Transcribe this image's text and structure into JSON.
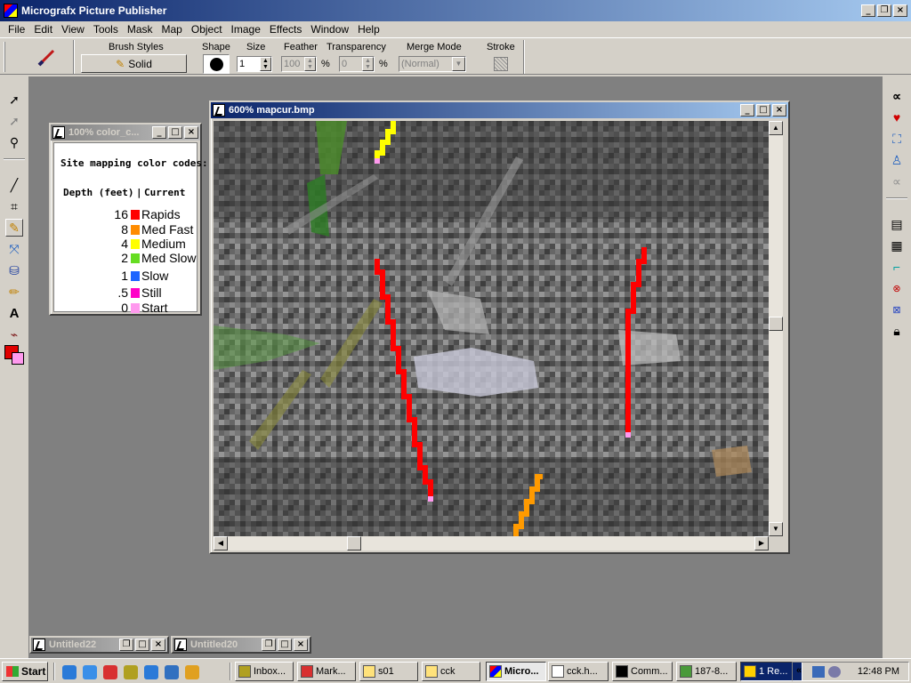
{
  "app": {
    "title": "Micrografx Picture Publisher",
    "menu": [
      "File",
      "Edit",
      "View",
      "Tools",
      "Mask",
      "Map",
      "Object",
      "Image",
      "Effects",
      "Window",
      "Help"
    ]
  },
  "toolbar": {
    "brush_styles_label": "Brush Styles",
    "brush_style_value": "Solid",
    "shape_label": "Shape",
    "size_label": "Size",
    "size_value": "1",
    "feather_label": "Feather",
    "feather_value": "100",
    "feather_unit": "%",
    "transparency_label": "Transparency",
    "transparency_value": "0",
    "transparency_unit": "%",
    "merge_mode_label": "Merge Mode",
    "merge_mode_value": "(Normal)",
    "stroke_label": "Stroke"
  },
  "legend_window": {
    "title": "100% color_c...",
    "heading": "Site mapping color codes:",
    "col_depth": "Depth (feet)",
    "col_sep": "|",
    "col_current": "Current",
    "rows": [
      {
        "depth": "16",
        "label": "Rapids",
        "color": "#ff0000"
      },
      {
        "depth": "8",
        "label": "Med Fast",
        "color": "#ff8c00"
      },
      {
        "depth": "4",
        "label": "Medium",
        "color": "#ffff00"
      },
      {
        "depth": "2",
        "label": "Med Slow",
        "color": "#66dd22"
      },
      {
        "depth": "1",
        "label": "Slow",
        "color": "#1e64ff"
      },
      {
        "depth": ".5",
        "label": "Still",
        "color": "#ff00c8"
      },
      {
        "depth": "0",
        "label": "Start",
        "color": "#ff99ee"
      }
    ]
  },
  "image_window": {
    "title": "600% mapcur.bmp"
  },
  "minimized": [
    {
      "title": "Untitled22"
    },
    {
      "title": "Untitled20"
    }
  ],
  "taskbar": {
    "start_label": "Start",
    "tasks": [
      {
        "label": "Inbox..."
      },
      {
        "label": "Mark..."
      },
      {
        "label": "s01"
      },
      {
        "label": "cck"
      },
      {
        "label": "Micro..."
      },
      {
        "label": "cck.h..."
      },
      {
        "label": "Comm..."
      },
      {
        "label": "187-8..."
      },
      {
        "label": "1 Re..."
      }
    ],
    "tray_chevron": "«",
    "clock": "12:48 PM"
  },
  "colors": {
    "titlebar_start": "#0a246a",
    "titlebar_end": "#a6caf0",
    "workspace": "#808080",
    "chrome": "#d4d0c8",
    "rapids": "#ff0000",
    "med_fast": "#ff8c00",
    "medium": "#ffff00",
    "start": "#ff99ee"
  }
}
